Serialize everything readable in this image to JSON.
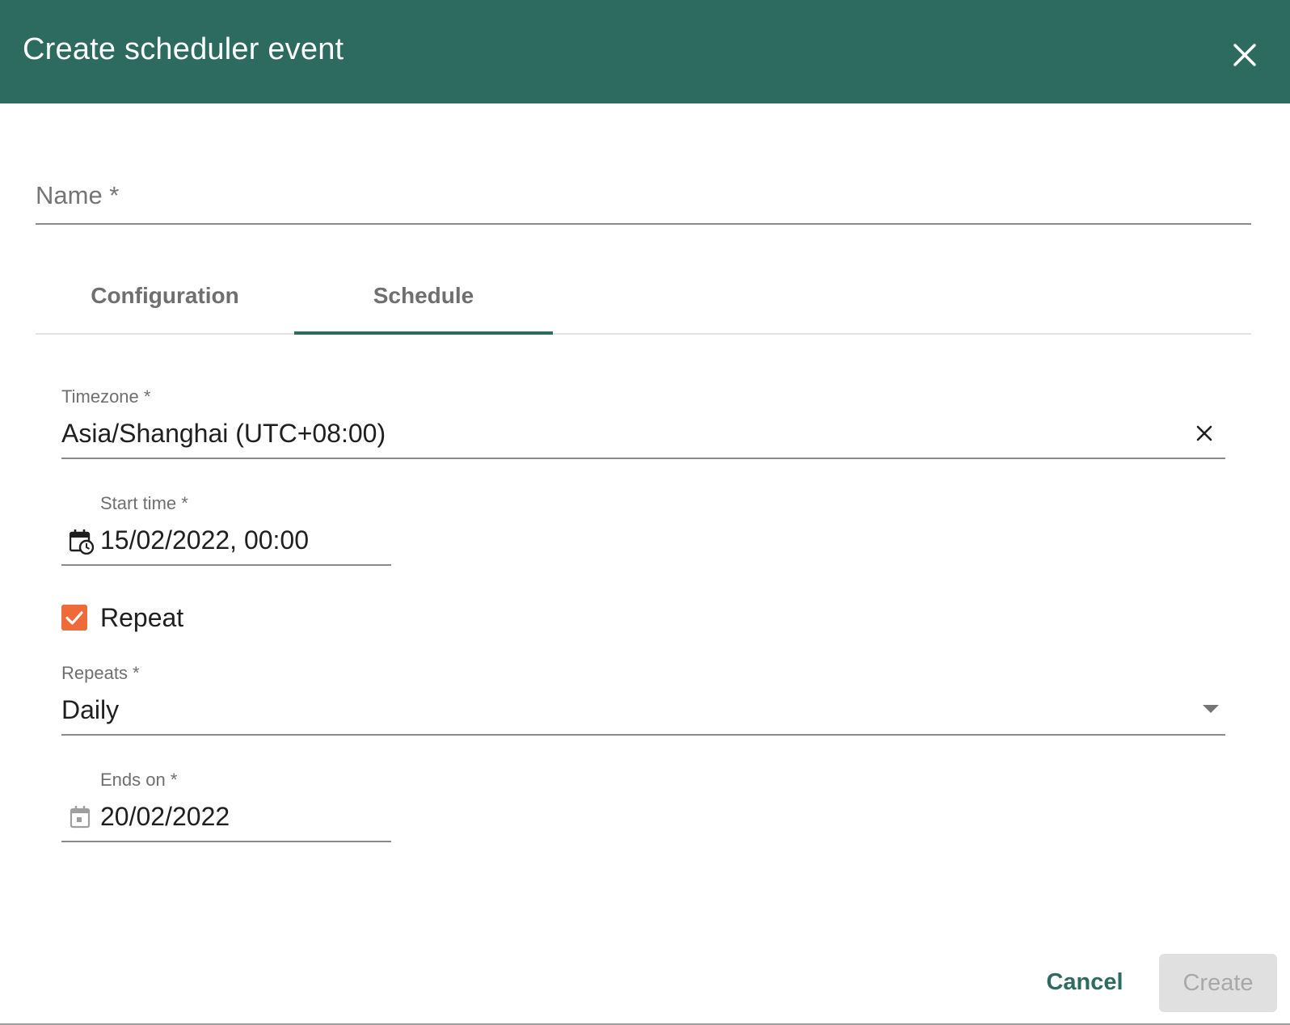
{
  "dialog": {
    "title": "Create scheduler event",
    "close_icon": "close-icon",
    "header_color": "#2d6a5f"
  },
  "name_field": {
    "placeholder": "Name *",
    "value": ""
  },
  "tabs": [
    {
      "label": "Configuration",
      "active": false
    },
    {
      "label": "Schedule",
      "active": true
    }
  ],
  "schedule": {
    "timezone": {
      "label": "Timezone *",
      "value": "Asia/Shanghai (UTC+08:00)",
      "clear_icon": "clear-icon"
    },
    "start_time": {
      "label": "Start time *",
      "value": "15/02/2022, 00:00",
      "icon": "calendar-clock-icon"
    },
    "repeat": {
      "label": "Repeat",
      "checked": true,
      "color": "#ee6a39"
    },
    "repeats": {
      "label": "Repeats *",
      "value": "Daily",
      "icon": "dropdown-arrow-icon"
    },
    "ends_on": {
      "label": "Ends on *",
      "value": "20/02/2022",
      "icon": "calendar-icon"
    }
  },
  "actions": {
    "cancel_label": "Cancel",
    "create_label": "Create",
    "create_disabled": true
  }
}
